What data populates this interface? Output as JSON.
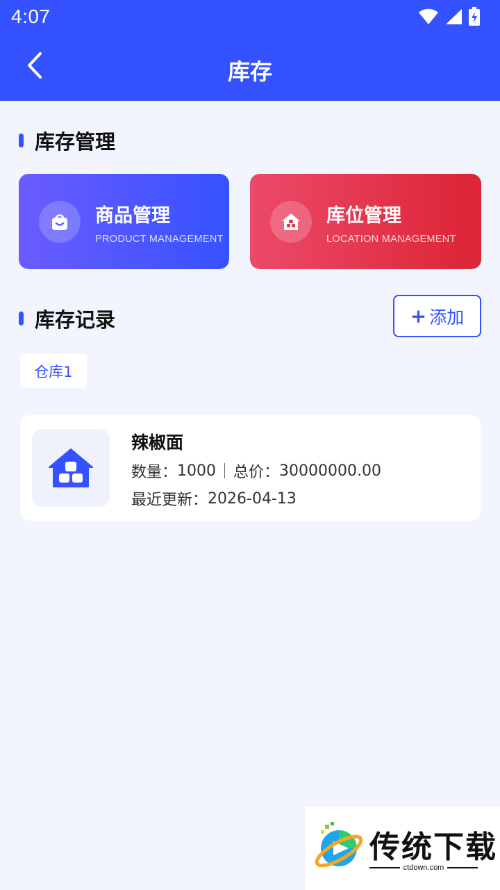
{
  "status_bar": {
    "time": "4:07",
    "icons": [
      "wifi-icon",
      "signal-icon",
      "battery-charging-icon"
    ]
  },
  "header": {
    "title": "库存",
    "back_icon": "chevron-left-icon",
    "background": "#3452ff"
  },
  "inventory_management": {
    "section_title": "库存管理",
    "cards": [
      {
        "title": "商品管理",
        "subtitle": "PRODUCT MANAGEMENT",
        "icon": "shopping-bag-icon"
      },
      {
        "title": "库位管理",
        "subtitle": "LOCATION MANAGEMENT",
        "icon": "warehouse-icon"
      }
    ]
  },
  "inventory_records": {
    "section_title": "库存记录",
    "add_button": {
      "plus": "+",
      "label": "添加"
    },
    "filter_chip": "仓库1",
    "records": [
      {
        "name": "辣椒面",
        "quantity_label": "数量：",
        "quantity": "1000",
        "total_label": "总价：",
        "total": "30000000.00",
        "updated_label": "最近更新：",
        "updated": "2026-04-13",
        "icon": "home-grid-icon"
      }
    ]
  },
  "watermark": {
    "text": "传统下载",
    "url": "ctdown.com"
  },
  "colors": {
    "primary": "#3452ff",
    "danger": "#dc2434",
    "page_bg": "#f2f5fe"
  }
}
